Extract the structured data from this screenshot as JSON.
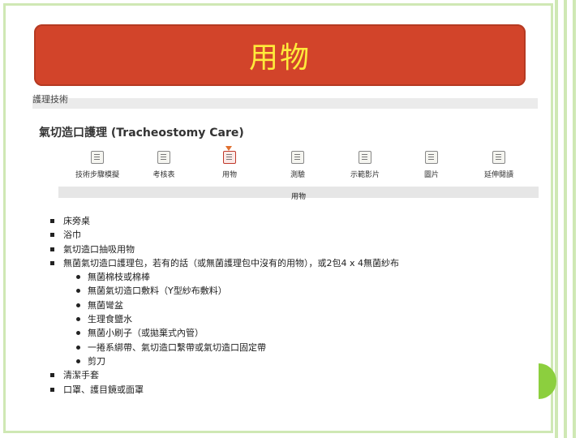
{
  "slide": {
    "title": "用物"
  },
  "breadcrumb": "護理技術",
  "page_title": "氣切造口護理 (Tracheostomy Care)",
  "nav": {
    "items": [
      {
        "label": "技術步驟模擬",
        "icon": "document-icon",
        "active": false
      },
      {
        "label": "考核表",
        "icon": "checklist-icon",
        "active": false
      },
      {
        "label": "用物",
        "icon": "supplies-icon",
        "active": true
      },
      {
        "label": "測驗",
        "icon": "quiz-icon",
        "active": false
      },
      {
        "label": "示範影片",
        "icon": "video-icon",
        "active": false
      },
      {
        "label": "圖片",
        "icon": "image-icon",
        "active": false
      },
      {
        "label": "延伸閱讀",
        "icon": "reading-icon",
        "active": false
      }
    ]
  },
  "section_title": "用物",
  "items": [
    {
      "text": "床旁桌",
      "level": 1
    },
    {
      "text": "浴巾",
      "level": 1
    },
    {
      "text": "氣切造口抽吸用物",
      "level": 1
    },
    {
      "text": "無菌氣切造口護理包，若有的話（或無菌護理包中沒有的用物），或2包4 x 4無菌紗布",
      "level": 1
    },
    {
      "text": "無菌棉枝或棉棒",
      "level": 2
    },
    {
      "text": "無菌氣切造口敷料（Y型紗布敷料）",
      "level": 2
    },
    {
      "text": "無菌彎盆",
      "level": 2
    },
    {
      "text": "生理食鹽水",
      "level": 2
    },
    {
      "text": "無菌小刷子（或拋棄式內管）",
      "level": 2
    },
    {
      "text": "一捲系綁帶、氣切造口繫帶或氣切造口固定帶",
      "level": 2
    },
    {
      "text": "剪刀",
      "level": 2
    },
    {
      "text": "清潔手套",
      "level": 1
    },
    {
      "text": "口罩、護目鏡或面罩",
      "level": 1
    }
  ],
  "colors": {
    "banner": "#d2442a",
    "title_text": "#ffeb3b",
    "frame": "#cfe8b4",
    "accent_dot": "#8ccf3e"
  }
}
